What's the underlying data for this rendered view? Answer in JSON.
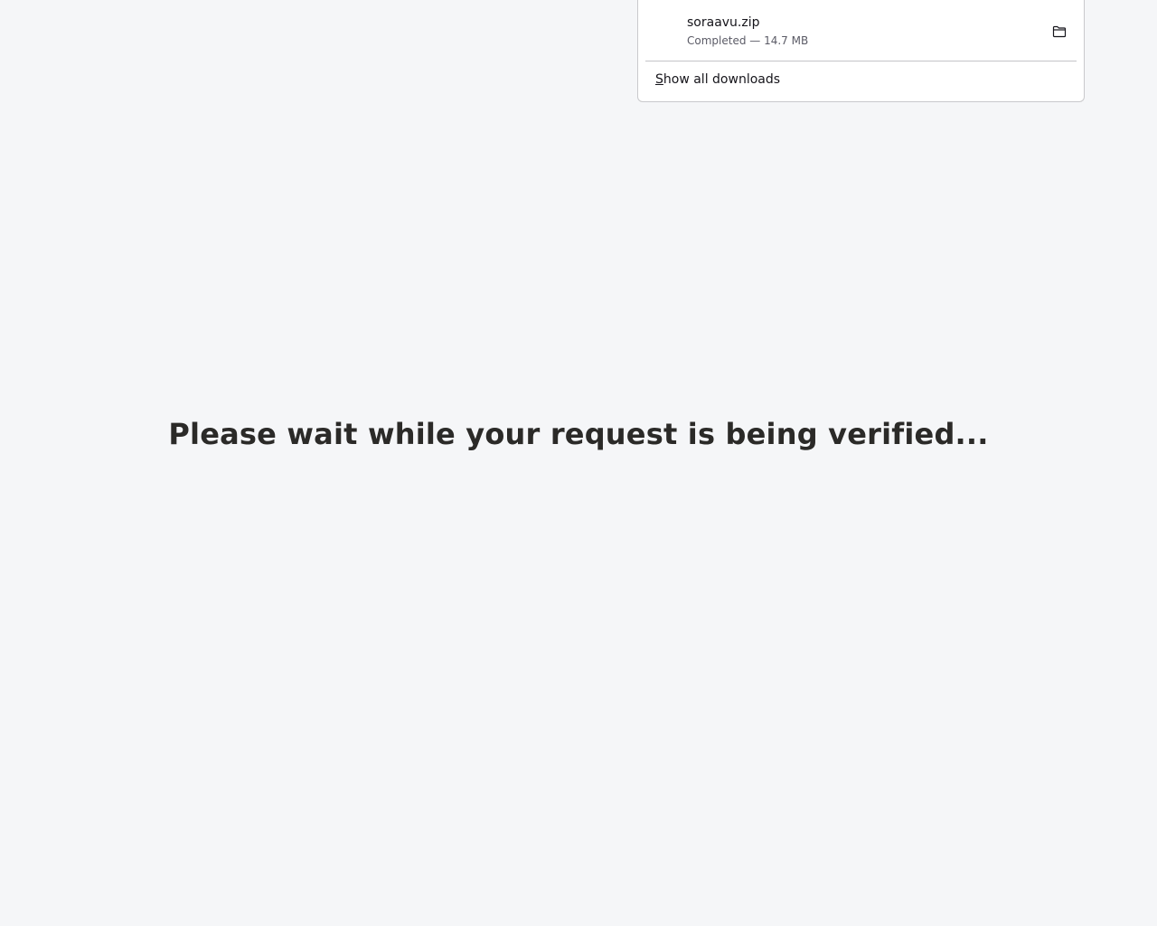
{
  "page": {
    "heading": "Please wait while your request is being verified..."
  },
  "downloads_panel": {
    "item": {
      "file_name": "soraavu.zip",
      "status": "Completed — 14.7 MB",
      "folder_icon": "folder-icon"
    },
    "show_all": {
      "accesskey": "S",
      "rest": "how all downloads"
    }
  },
  "colors": {
    "background": "#f5f6f8",
    "heading_text": "#2b2a28",
    "panel_background": "#ffffff",
    "panel_border": "#c9c9cc",
    "secondary_text": "#5b5b66"
  }
}
